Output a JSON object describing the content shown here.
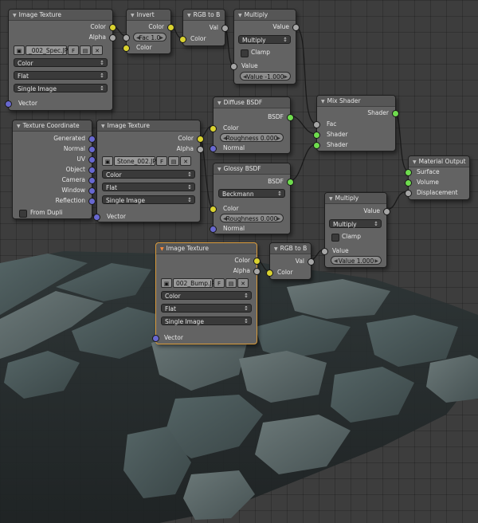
{
  "nodes": {
    "spec_texture": {
      "title": "Image Texture",
      "outputs": [
        "Color",
        "Alpha"
      ],
      "image_name": "_002_Spec.JPG",
      "fake_user": "F",
      "color_mode": "Color",
      "projection": "Flat",
      "source": "Single Image",
      "input": "Vector"
    },
    "invert": {
      "title": "Invert",
      "output": "Color",
      "fac_field": "Fac 1.0",
      "input": "Color"
    },
    "rgb_to_bw_top": {
      "title": "RGB to B",
      "output": "Val",
      "input": "Color"
    },
    "multiply_top": {
      "title": "Multiply",
      "output": "Value",
      "operation": "Multiply",
      "clamp_label": "Clamp",
      "input": "Value",
      "value_field": "Value -1.000"
    },
    "texture_coordinate": {
      "title": "Texture Coordinate",
      "outputs": [
        "Generated",
        "Normal",
        "UV",
        "Object",
        "Camera",
        "Window",
        "Reflection"
      ],
      "from_dupli": "From Dupli"
    },
    "stone_texture": {
      "title": "Image Texture",
      "outputs": [
        "Color",
        "Alpha"
      ],
      "image_name": "Stone_002.JPG",
      "fake_user": "F",
      "color_mode": "Color",
      "projection": "Flat",
      "source": "Single Image",
      "input": "Vector"
    },
    "diffuse": {
      "title": "Diffuse BSDF",
      "output": "BSDF",
      "input_color": "Color",
      "roughness_field": "Roughness 0.000",
      "input_normal": "Normal"
    },
    "glossy": {
      "title": "Glossy BSDF",
      "output": "BSDF",
      "distribution": "Beckmann",
      "input_color": "Color",
      "roughness_field": "Roughness 0.000",
      "input_normal": "Normal"
    },
    "mix_shader": {
      "title": "Mix Shader",
      "output": "Shader",
      "inputs": [
        "Fac",
        "Shader",
        "Shader"
      ]
    },
    "material_output": {
      "title": "Material Output",
      "inputs": [
        "Surface",
        "Volume",
        "Displacement"
      ]
    },
    "multiply_bottom": {
      "title": "Multiply",
      "output": "Value",
      "operation": "Multiply",
      "clamp_label": "Clamp",
      "input": "Value",
      "value_field": "Value 1.000"
    },
    "bump_texture": {
      "title": "Image Texture",
      "outputs": [
        "Color",
        "Alpha"
      ],
      "image_name": "002_Bump.JPG",
      "fake_user": "F",
      "color_mode": "Color",
      "projection": "Flat",
      "source": "Single Image",
      "input": "Vector"
    },
    "rgb_to_bw_bottom": {
      "title": "RGB to B",
      "output": "Val",
      "input": "Color"
    }
  },
  "colors": {
    "background": "#3d3d3d",
    "node_body": "#636363",
    "node_header": "#565656",
    "selected_outline": "#d99a3a",
    "socket_color": "#d9d230",
    "socket_shader": "#6fdc4e",
    "socket_value": "#a6a6a6",
    "socket_vector": "#6868d0"
  }
}
